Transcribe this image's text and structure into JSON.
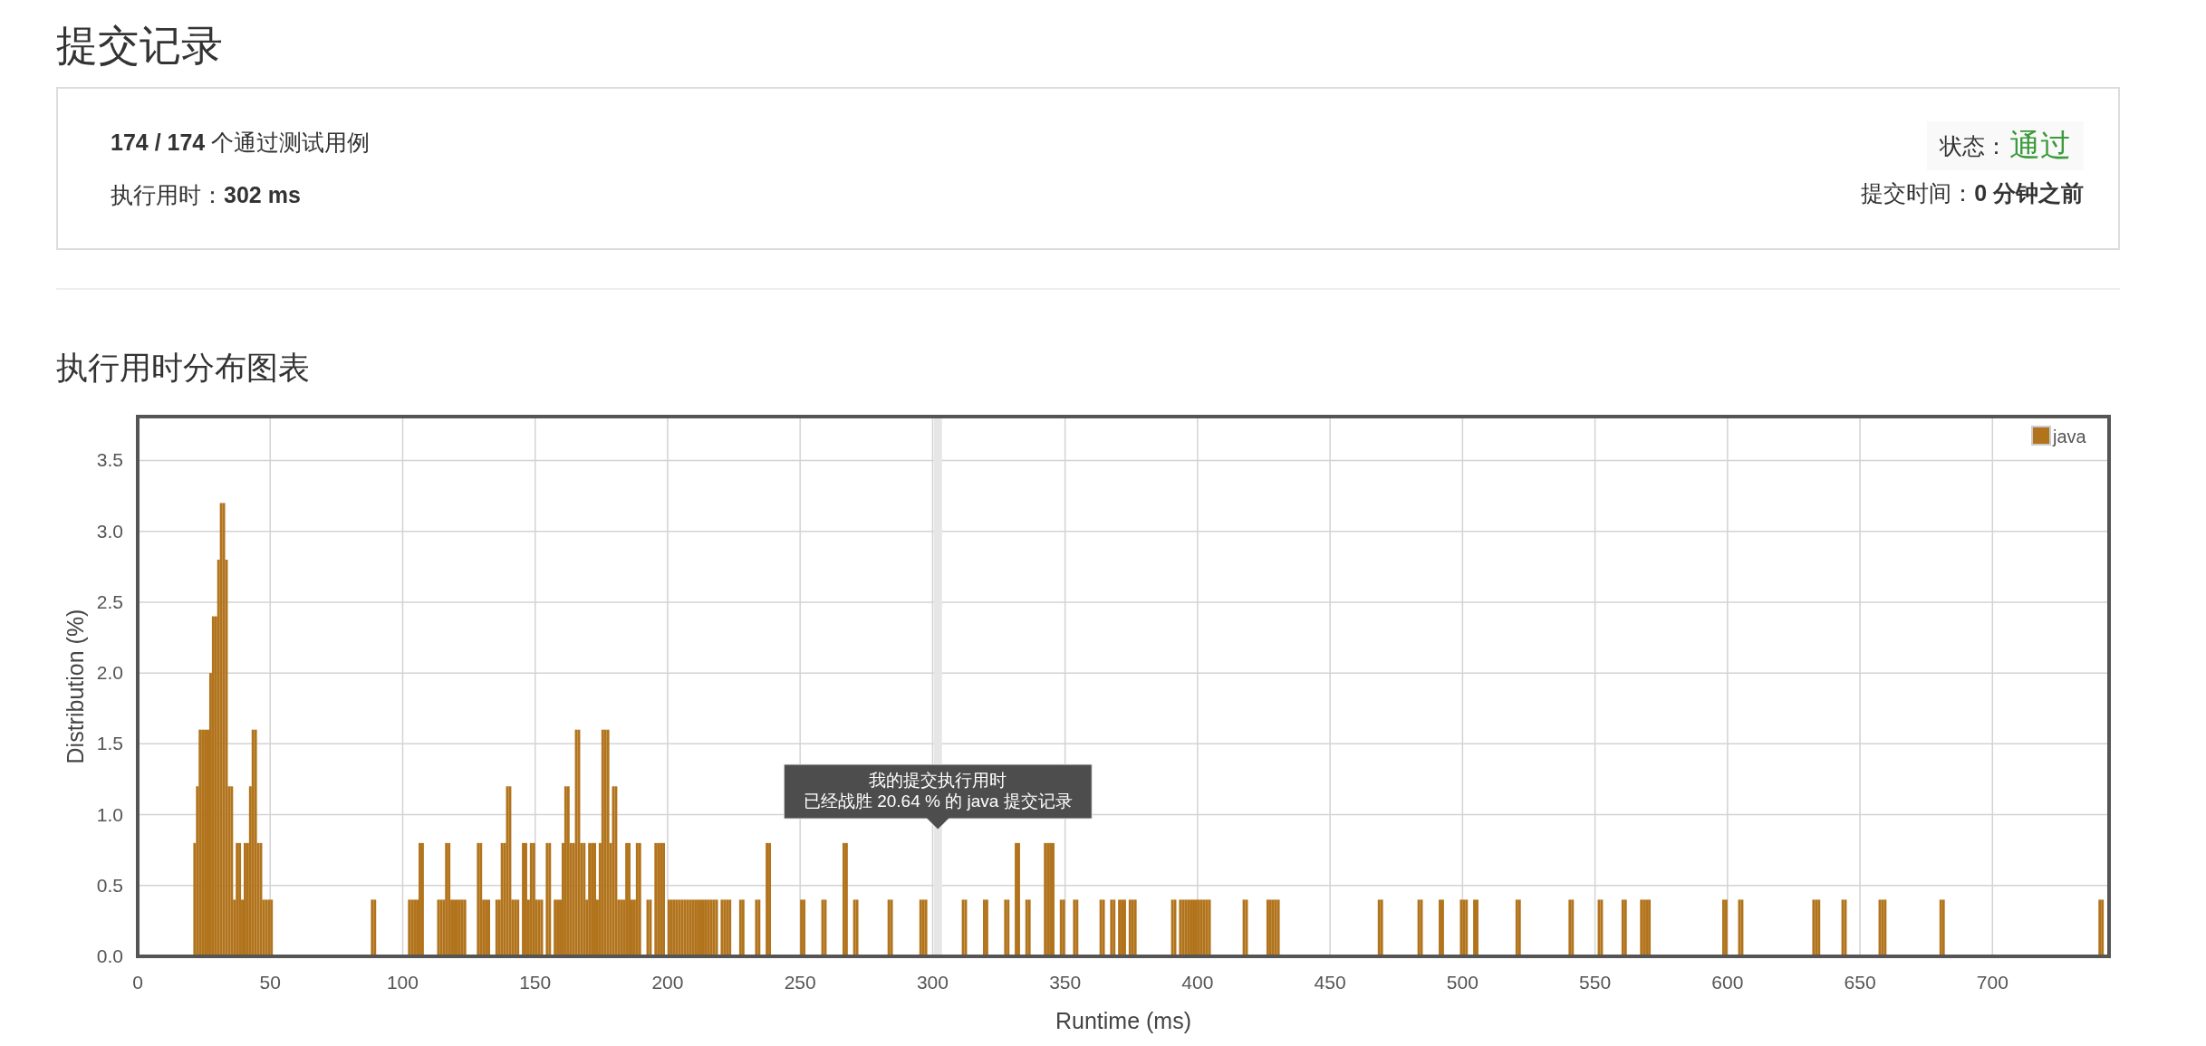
{
  "title": "提交记录",
  "summary": {
    "test_cases": "**174 / 174** 个通过测试用例",
    "runtime": "执行用时：**302 ms**",
    "status_label": "状态：",
    "status": {
      "text": "通过",
      "kind": "accepted"
    },
    "submit_time": "提交时间：**0 分钟之前**"
  },
  "section_title": "执行用时分布图表",
  "chart": {
    "chart_data": {
      "type": "bar",
      "xlabel": "Runtime (ms)",
      "ylabel": "Distribution (%)",
      "xlim": [
        0,
        744
      ],
      "ylim": [
        0,
        3.81
      ],
      "xticks": [
        0,
        50,
        100,
        150,
        200,
        250,
        300,
        350,
        400,
        450,
        500,
        550,
        600,
        650,
        700
      ],
      "yticks": [
        {
          "value": 0,
          "label": "0.0"
        },
        {
          "value": 0.5,
          "label": "0.5"
        },
        {
          "value": 1,
          "label": "1.0"
        },
        {
          "value": 1.5,
          "label": "1.5"
        },
        {
          "value": 2,
          "label": "2.0"
        },
        {
          "value": 2.5,
          "label": "2.5"
        },
        {
          "value": 3,
          "label": "3.0"
        },
        {
          "value": 3.5,
          "label": "3.5"
        }
      ],
      "x": [
        21,
        22,
        23,
        24,
        25,
        26,
        27,
        28,
        29,
        30,
        31,
        32,
        33,
        34,
        35,
        36,
        37,
        38,
        39,
        40,
        41,
        42,
        43,
        44,
        45,
        46,
        47,
        48,
        49,
        50,
        88,
        89,
        102,
        103,
        104,
        105,
        106,
        107,
        113,
        114,
        115,
        116,
        117,
        118,
        119,
        120,
        121,
        122,
        123,
        128,
        129,
        130,
        131,
        132,
        135,
        136,
        137,
        138,
        139,
        140,
        141,
        142,
        143,
        145,
        146,
        147,
        148,
        149,
        150,
        151,
        152,
        154,
        155,
        157,
        158,
        159,
        160,
        161,
        162,
        163,
        164,
        165,
        166,
        167,
        168,
        169,
        170,
        171,
        172,
        173,
        174,
        175,
        176,
        177,
        178,
        179,
        180,
        181,
        182,
        183,
        184,
        185,
        186,
        187,
        188,
        189,
        192,
        193,
        195,
        196,
        197,
        198,
        200,
        201,
        202,
        203,
        204,
        205,
        206,
        207,
        208,
        209,
        210,
        211,
        212,
        213,
        214,
        215,
        216,
        217,
        218,
        220,
        221,
        222,
        223,
        227,
        228,
        233,
        234,
        237,
        238,
        250,
        251,
        258,
        259,
        266,
        267,
        270,
        271,
        283,
        284,
        295,
        296,
        297,
        311,
        312,
        319,
        320,
        327,
        328,
        331,
        332,
        335,
        336,
        342,
        343,
        344,
        345,
        348,
        349,
        353,
        354,
        363,
        364,
        367,
        368,
        370,
        371,
        372,
        374,
        375,
        376,
        390,
        391,
        393,
        394,
        395,
        396,
        397,
        398,
        399,
        400,
        401,
        402,
        403,
        404,
        417,
        418,
        426,
        427,
        428,
        429,
        430,
        468,
        469,
        483,
        484,
        491,
        492,
        499,
        500,
        501,
        504,
        505,
        520,
        521,
        540,
        541,
        551,
        552,
        560,
        561,
        567,
        568,
        569,
        570,
        598,
        599,
        604,
        605,
        632,
        633,
        634,
        643,
        644,
        657,
        658,
        659,
        680,
        681,
        740,
        741
      ],
      "series": [
        {
          "name": "java",
          "color": "#b1731b",
          "values": [
            0.8,
            1.2,
            1.6,
            1.6,
            1.6,
            1.6,
            2.0,
            2.4,
            2.4,
            2.8,
            3.2,
            3.2,
            2.8,
            1.2,
            1.2,
            0.4,
            0.8,
            0.8,
            0.4,
            0.8,
            0.8,
            1.2,
            1.6,
            1.6,
            0.8,
            0.8,
            0.4,
            0.4,
            0.4,
            0.4,
            0.4,
            0.4,
            0.4,
            0.4,
            0.4,
            0.4,
            0.8,
            0.8,
            0.4,
            0.4,
            0.4,
            0.8,
            0.8,
            0.4,
            0.4,
            0.4,
            0.4,
            0.4,
            0.4,
            0.8,
            0.8,
            0.4,
            0.4,
            0.4,
            0.4,
            0.4,
            0.8,
            0.8,
            1.2,
            1.2,
            0.4,
            0.4,
            0.4,
            0.8,
            0.8,
            0.4,
            0.8,
            0.8,
            0.4,
            0.4,
            0.4,
            0.8,
            0.8,
            0.4,
            0.4,
            0.4,
            0.8,
            1.2,
            1.2,
            0.8,
            0.8,
            1.6,
            1.6,
            0.8,
            0.8,
            0.4,
            0.8,
            0.8,
            0.8,
            0.4,
            0.8,
            1.6,
            1.6,
            1.6,
            0.8,
            1.2,
            1.2,
            0.4,
            0.4,
            0.4,
            0.8,
            0.8,
            0.4,
            0.4,
            0.8,
            0.8,
            0.4,
            0.4,
            0.8,
            0.8,
            0.8,
            0.8,
            0.4,
            0.4,
            0.4,
            0.4,
            0.4,
            0.4,
            0.4,
            0.4,
            0.4,
            0.4,
            0.4,
            0.4,
            0.4,
            0.4,
            0.4,
            0.4,
            0.4,
            0.4,
            0.4,
            0.4,
            0.4,
            0.4,
            0.4,
            0.4,
            0.4,
            0.4,
            0.4,
            0.8,
            0.8,
            0.4,
            0.4,
            0.4,
            0.4,
            0.8,
            0.8,
            0.4,
            0.4,
            0.4,
            0.4,
            0.4,
            0.4,
            0.4,
            0.4,
            0.4,
            0.4,
            0.4,
            0.4,
            0.4,
            0.8,
            0.8,
            0.4,
            0.4,
            0.8,
            0.8,
            0.8,
            0.8,
            0.4,
            0.4,
            0.4,
            0.4,
            0.4,
            0.4,
            0.4,
            0.4,
            0.4,
            0.4,
            0.4,
            0.4,
            0.4,
            0.4,
            0.4,
            0.4,
            0.4,
            0.4,
            0.4,
            0.4,
            0.4,
            0.4,
            0.4,
            0.4,
            0.4,
            0.4,
            0.4,
            0.4,
            0.4,
            0.4,
            0.4,
            0.4,
            0.4,
            0.4,
            0.4,
            0.4,
            0.4,
            0.4,
            0.4,
            0.4,
            0.4,
            0.4,
            0.4,
            0.4,
            0.4,
            0.4,
            0.4,
            0.4,
            0.4,
            0.4,
            0.4,
            0.4,
            0.4,
            0.4,
            0.4,
            0.4,
            0.4,
            0.4,
            0.4,
            0.4,
            0.4,
            0.4,
            0.4,
            0.4,
            0.4,
            0.4,
            0.4,
            0.4,
            0.4,
            0.4,
            0.4,
            0.4,
            0.4,
            0.4
          ]
        }
      ],
      "grid": true,
      "ref_lines": [
        {
          "axis": "x",
          "value": 302,
          "color": "#e6e6e6",
          "label": [
            "我的提交执行用时",
            "已经战胜 20.64 % 的 java 提交记录"
          ]
        }
      ]
    }
  }
}
